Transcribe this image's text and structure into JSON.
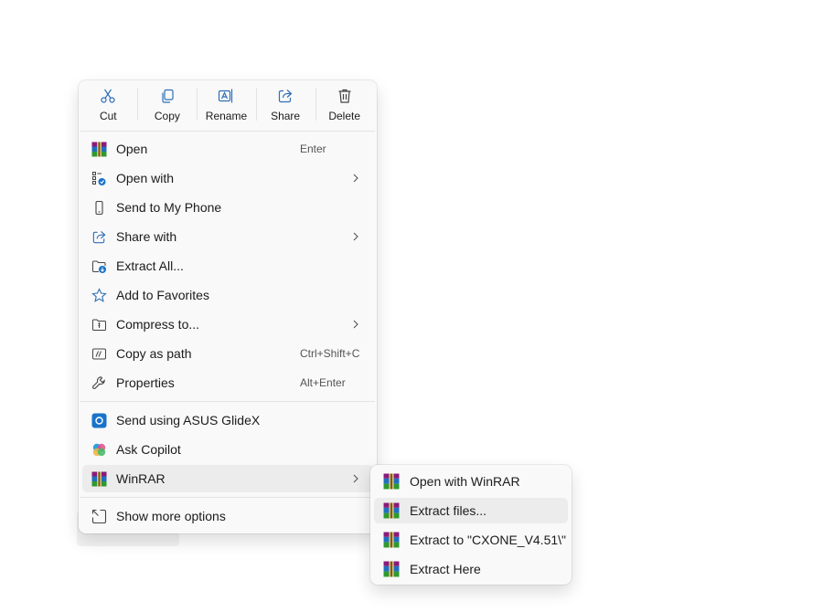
{
  "toolbar": {
    "cut": "Cut",
    "copy": "Copy",
    "rename": "Rename",
    "share": "Share",
    "delete": "Delete"
  },
  "menu": {
    "open": {
      "label": "Open",
      "shortcut": "Enter"
    },
    "open_with": {
      "label": "Open with"
    },
    "send_to_phone": {
      "label": "Send to My Phone"
    },
    "share_with": {
      "label": "Share with"
    },
    "extract_all": {
      "label": "Extract All..."
    },
    "add_favorites": {
      "label": "Add to Favorites"
    },
    "compress_to": {
      "label": "Compress to..."
    },
    "copy_as_path": {
      "label": "Copy as path",
      "shortcut": "Ctrl+Shift+C"
    },
    "properties": {
      "label": "Properties",
      "shortcut": "Alt+Enter"
    },
    "send_glidex": {
      "label": "Send using ASUS GlideX"
    },
    "ask_copilot": {
      "label": "Ask Copilot"
    },
    "winrar": {
      "label": "WinRAR"
    },
    "show_more": {
      "label": "Show more options"
    }
  },
  "submenu": {
    "open_with_winrar": "Open with WinRAR",
    "extract_files": "Extract files...",
    "extract_to": "Extract to \"CXONE_V4.51\\\"",
    "extract_here": "Extract Here"
  },
  "colors": {
    "accent": "#1a73c9",
    "menu_bg": "#f9f9f9",
    "hover_bg": "#ececec"
  }
}
